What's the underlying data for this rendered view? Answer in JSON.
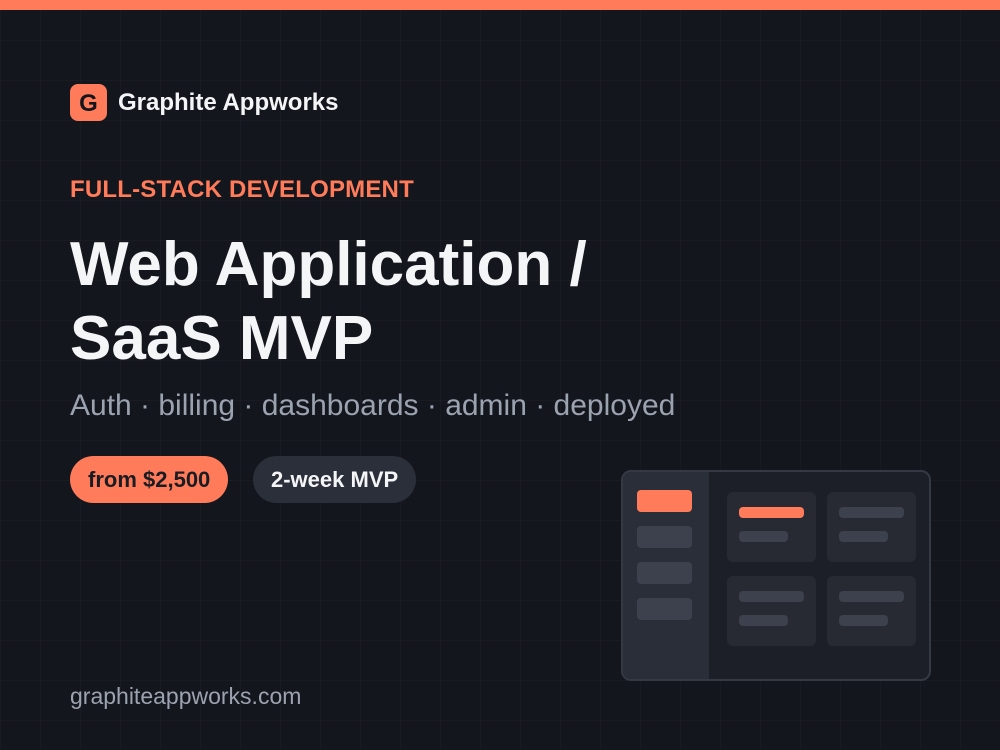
{
  "brand": {
    "logo_letter": "G",
    "name": "Graphite Appworks"
  },
  "hero": {
    "eyebrow": "FULL-STACK DEVELOPMENT",
    "title_line1": "Web Application /",
    "title_line2": "SaaS MVP",
    "subtitle": "Auth · billing · dashboards · admin · deployed"
  },
  "pills": {
    "price": "from $2,500",
    "duration": "2-week MVP"
  },
  "footer": {
    "url": "graphiteappworks.com"
  },
  "colors": {
    "accent": "#ff7b59",
    "background": "#14161d",
    "text": "#f4f5f7",
    "muted_text": "#9ca3b0",
    "pill_dark": "#2b2f39"
  },
  "illustration": {
    "icon": "dashboard-mockup-icon",
    "sidebar_items": 4,
    "active_sidebar_item": 1,
    "cards": 4,
    "highlighted_card": 1
  }
}
